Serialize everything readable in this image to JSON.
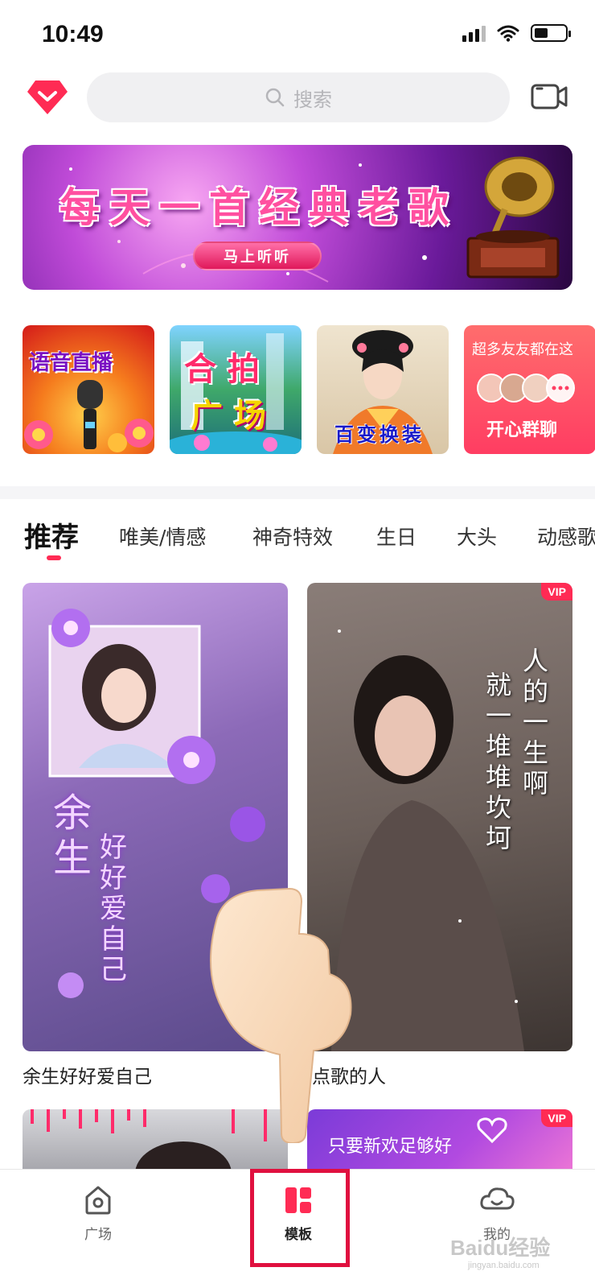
{
  "status_bar": {
    "time": "10:49",
    "battery_level": 0.45
  },
  "header": {
    "search_placeholder": "搜索",
    "icons": {
      "vip": "diamond-vip-icon",
      "search": "search-icon",
      "camera": "video-camera-icon"
    }
  },
  "banner": {
    "title": "每天一首经典老歌",
    "button_label": "马上听听"
  },
  "quick_entries": [
    {
      "label": "语音直播"
    },
    {
      "label_line1": "合拍",
      "label_line2": "广场"
    },
    {
      "label": "百变换装"
    },
    {
      "top_text": "超多友友都在这",
      "label": "开心群聊"
    }
  ],
  "tabs": [
    "推荐",
    "唯美/情感",
    "神奇特效",
    "生日",
    "大头",
    "动感歌"
  ],
  "templates": [
    {
      "caption": "余生好好爱自己",
      "overlay_big": "余生",
      "overlay_small": "好好爱自己",
      "vip": false
    },
    {
      "caption": "点歌的人",
      "overlay_line1": "人的一生啊",
      "overlay_line2": "就一堆堆坎坷",
      "vip": true,
      "vip_label": "VIP"
    },
    {
      "caption": "",
      "vip": false
    },
    {
      "caption": "",
      "overlay": "只要新欢足够好",
      "vip": true,
      "vip_label": "VIP"
    }
  ],
  "bottom_nav": [
    {
      "label": "广场",
      "icon": "home-icon"
    },
    {
      "label": "模板",
      "icon": "template-grid-icon",
      "active": true
    },
    {
      "label": "我的",
      "icon": "profile-cloud-icon"
    }
  ],
  "watermark": {
    "main": "Baidu经验",
    "sub": "jingyan.baidu.com"
  },
  "colors": {
    "accent": "#ff2b54",
    "highlight": "#e0103f"
  }
}
